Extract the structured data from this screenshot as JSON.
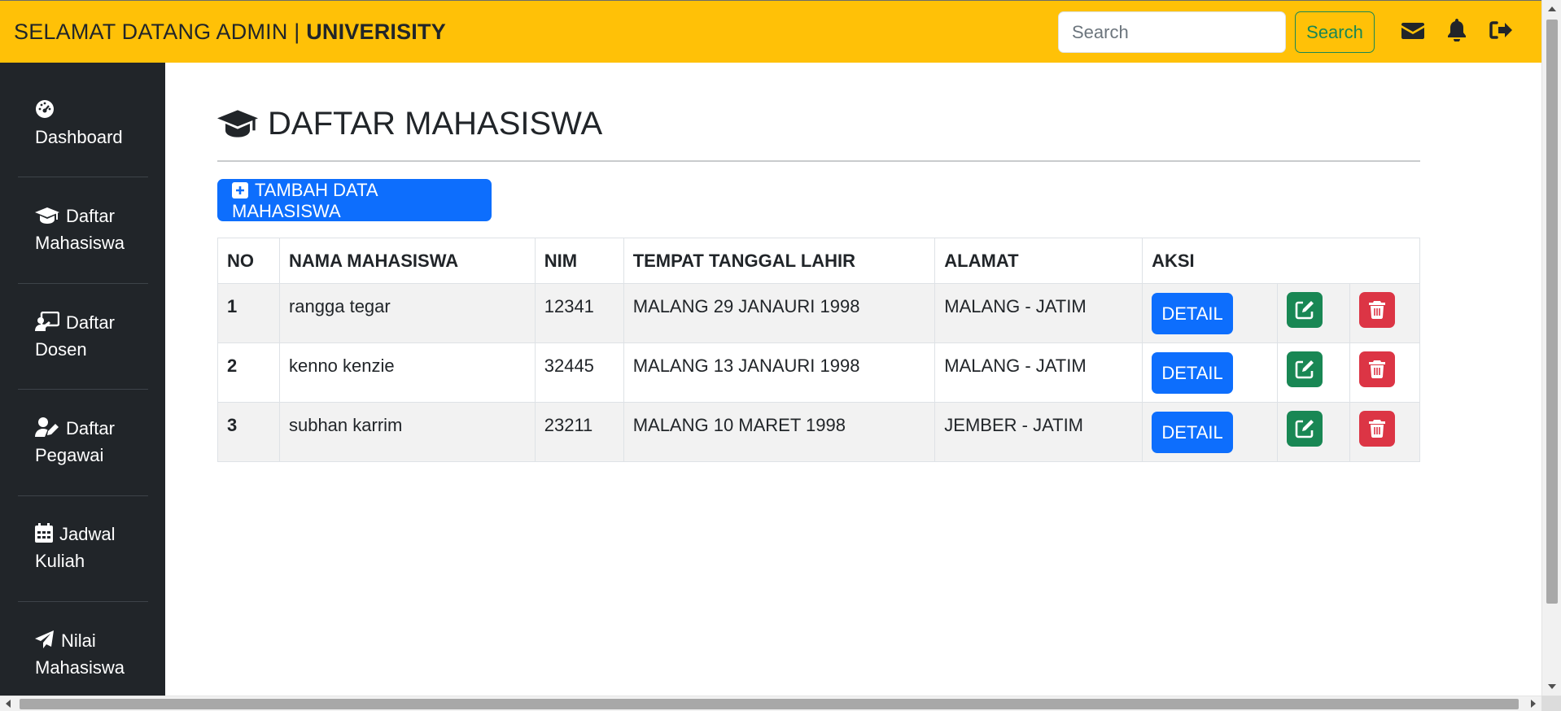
{
  "navbar": {
    "brand_prefix": "SELAMAT DATANG ADMIN | ",
    "brand_bold": "UNIVERISITY",
    "search": {
      "placeholder": "Search",
      "value": ""
    },
    "search_button": "Search",
    "icons": [
      "envelope-icon",
      "bell-icon",
      "sign-out-icon"
    ],
    "background": "#ffc107"
  },
  "sidebar": {
    "items": [
      {
        "label": "Dashboard",
        "icon": "tachometer-icon"
      },
      {
        "label": "Daftar Mahasiswa",
        "icon": "graduation-cap-icon"
      },
      {
        "label": "Daftar Dosen",
        "icon": "chalkboard-teacher-icon"
      },
      {
        "label": "Daftar Pegawai",
        "icon": "user-edit-icon"
      },
      {
        "label": "Jadwal Kuliah",
        "icon": "calendar-icon"
      },
      {
        "label": "Nilai Mahasiswa",
        "icon": "paper-plane-icon"
      }
    ],
    "background": "#212529"
  },
  "main": {
    "title": "DAFTAR MAHASISWA",
    "title_icon": "graduation-cap-icon",
    "add_button": "TAMBAH DATA MAHASISWA",
    "table": {
      "headers": [
        "NO",
        "NAMA MAHASISWA",
        "NIM",
        "TEMPAT TANGGAL LAHIR",
        "ALAMAT",
        "AKSI"
      ],
      "rows": [
        {
          "no": "1",
          "nama": "rangga tegar",
          "nim": "12341",
          "ttl": "MALANG 29 JANAURI 1998",
          "alamat": "MALANG - JATIM"
        },
        {
          "no": "2",
          "nama": "kenno kenzie",
          "nim": "32445",
          "ttl": "MALANG 13 JANAURI 1998",
          "alamat": "MALANG - JATIM"
        },
        {
          "no": "3",
          "nama": "subhan karrim",
          "nim": "23211",
          "ttl": "MALANG 10 MARET 1998",
          "alamat": "JEMBER - JATIM"
        }
      ],
      "detail_label": "DETAIL"
    }
  },
  "colors": {
    "primary": "#0d6efd",
    "success": "#198754",
    "danger": "#dc3545",
    "warning": "#ffc107",
    "dark": "#212529"
  }
}
